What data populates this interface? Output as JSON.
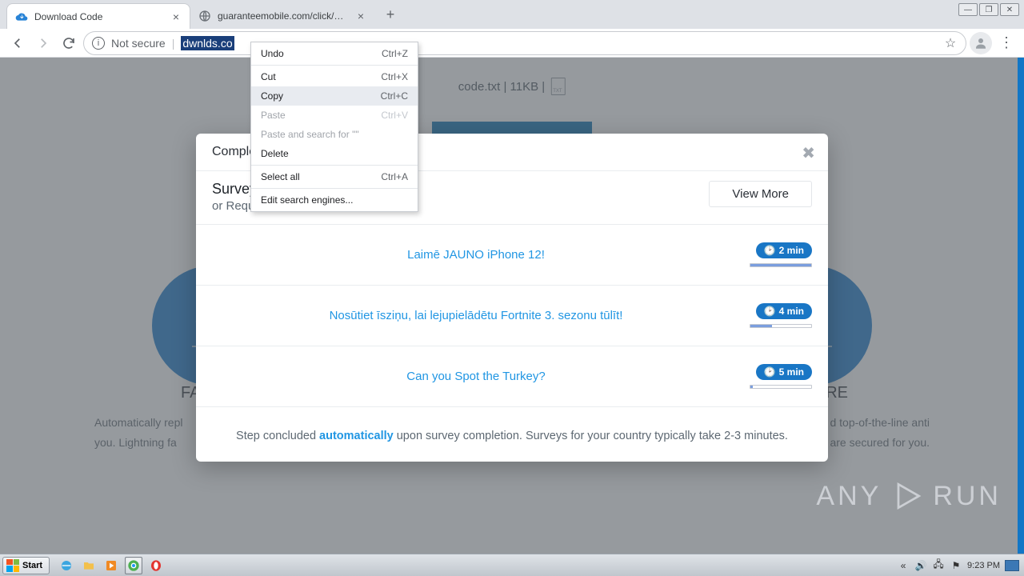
{
  "browser": {
    "tabs": [
      {
        "title": "Download Code",
        "favicon_color": "#2883d6"
      },
      {
        "title": "guaranteemobile.com/click/ZGpkbmd",
        "favicon_color": "#888c92"
      }
    ],
    "omnibox": {
      "security_label": "Not secure",
      "url_selected": "dwnlds.co"
    }
  },
  "context_menu": {
    "items": [
      {
        "label": "Undo",
        "shortcut": "Ctrl+Z",
        "disabled": false
      },
      {
        "sep": true
      },
      {
        "label": "Cut",
        "shortcut": "Ctrl+X",
        "disabled": false
      },
      {
        "label": "Copy",
        "shortcut": "Ctrl+C",
        "disabled": false,
        "hover": true
      },
      {
        "label": "Paste",
        "shortcut": "Ctrl+V",
        "disabled": true
      },
      {
        "label": "Paste and search for \"\"",
        "shortcut": "",
        "disabled": true
      },
      {
        "label": "Delete",
        "shortcut": "",
        "disabled": false
      },
      {
        "sep": true
      },
      {
        "label": "Select all",
        "shortcut": "Ctrl+A",
        "disabled": false
      },
      {
        "sep": true
      },
      {
        "label": "Edit search engines...",
        "shortcut": "",
        "disabled": false
      }
    ]
  },
  "page": {
    "file_line": "code.txt | 11KB |",
    "bg_heading_left": "FA",
    "bg_heading_right": "URE",
    "bg_para_left": "Automatically repl                                            you. Lightning fa",
    "bg_para_right_l1": "d top-of-the-line anti",
    "bg_para_right_l2": "s are secured for you."
  },
  "modal": {
    "header": "Complete",
    "surveys_title": "Surveys",
    "surveys_sub": "or Requirement",
    "view_more": "View More",
    "items": [
      {
        "link": "Laimē JAUNO iPhone 12!",
        "time": "2 min",
        "progress": 100
      },
      {
        "link": "Nosūtiet īsziņu, lai lejupielādētu Fortnite 3. sezonu tūlīt!",
        "time": "4 min",
        "progress": 35
      },
      {
        "link": "Can you Spot the Turkey?",
        "time": "5 min",
        "progress": 4
      }
    ],
    "footer_pre": "Step concluded ",
    "footer_auto": "automatically",
    "footer_post": " upon survey completion. Surveys for your country typically take 2-3 minutes."
  },
  "watermark": {
    "left": "ANY",
    "right": "RUN"
  },
  "taskbar": {
    "start": "Start",
    "clock": "9:23 PM"
  }
}
